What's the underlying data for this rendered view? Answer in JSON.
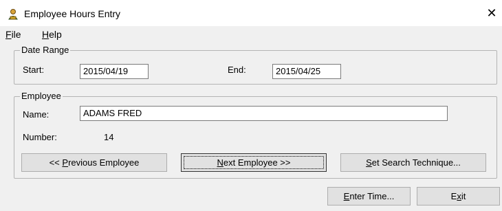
{
  "window": {
    "title": "Employee Hours Entry",
    "close_glyph": "✕"
  },
  "menu": {
    "file_mnemonic": "F",
    "file_rest": "ile",
    "help_mnemonic": "H",
    "help_rest": "elp"
  },
  "date_range": {
    "group_label": "Date Range",
    "start_label": "Start:",
    "start_value": "2015/04/19",
    "end_label": "End:",
    "end_value": "2015/04/25"
  },
  "employee": {
    "group_label": "Employee",
    "name_label": "Name:",
    "name_value": "ADAMS FRED",
    "number_label": "Number:",
    "number_value": "14"
  },
  "buttons": {
    "previous_pre": "<< ",
    "previous_mnemonic": "P",
    "previous_rest": "revious Employee",
    "next_mnemonic": "N",
    "next_rest": "ext Employee >>",
    "search_mnemonic": "S",
    "search_rest": "et Search Technique...",
    "enter_mnemonic": "E",
    "enter_rest": "nter Time...",
    "exit_pre": "E",
    "exit_mnemonic": "x",
    "exit_rest": "it"
  }
}
